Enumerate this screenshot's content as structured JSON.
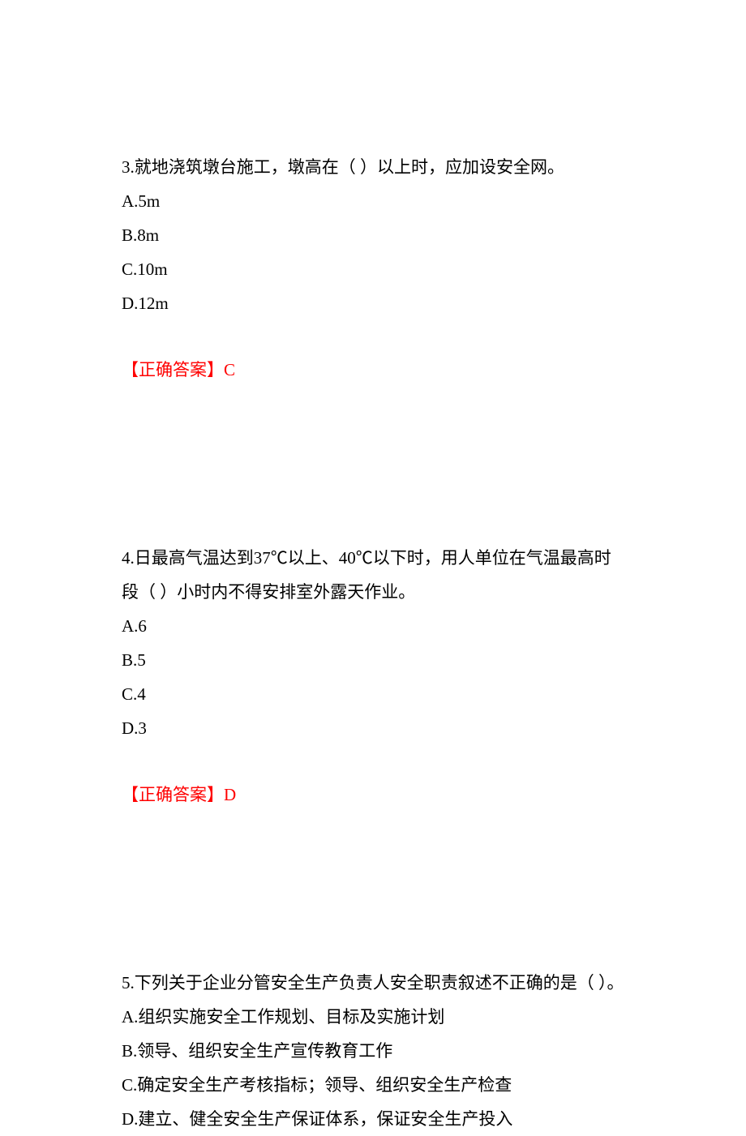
{
  "questions": [
    {
      "number": "3.",
      "text": "就地浇筑墩台施工，墩高在（   ）以上时，应加设安全网。",
      "options": {
        "A": "A.5m",
        "B": "B.8m",
        "C": "C.10m",
        "D": "D.12m"
      },
      "answer_label": "【正确答案】",
      "answer_value": "C"
    },
    {
      "number": "4.",
      "text": "日最高气温达到37℃以上、40℃以下时，用人单位在气温最高时段（   ）小时内不得安排室外露天作业。",
      "options": {
        "A": "A.6",
        "B": "B.5",
        "C": "C.4",
        "D": "D.3"
      },
      "answer_label": "【正确答案】",
      "answer_value": "D"
    },
    {
      "number": "5.",
      "text": "下列关于企业分管安全生产负责人安全职责叙述不正确的是（   ）。",
      "options": {
        "A": "A.组织实施安全工作规划、目标及实施计划",
        "B": "B.领导、组织安全生产宣传教育工作",
        "C": "C.确定安全生产考核指标；领导、组织安全生产检查",
        "D": "D.建立、健全安全生产保证体系，保证安全生产投入"
      },
      "answer_label": "",
      "answer_value": ""
    }
  ]
}
